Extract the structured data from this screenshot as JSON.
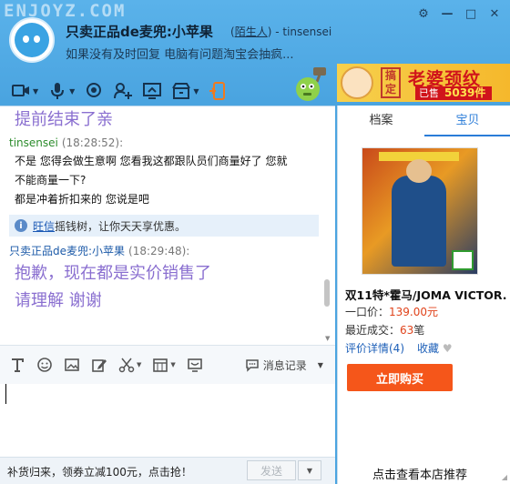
{
  "title_bar": {
    "watermark": "ENJOYZ.COM",
    "contact_name": "只卖正品de麦兜:小苹果",
    "tag_open": "(",
    "tag": "陌生人",
    "tag_close": ")",
    "account": "- tinsensei",
    "status": "如果没有及时回复  电脑有问题淘宝会抽疯..."
  },
  "toolbar": {
    "icons": [
      "video-call-icon",
      "voice-icon",
      "webcam-icon",
      "add-contact-icon",
      "remote-screen-icon",
      "shop-icon",
      "transfer-phone-icon"
    ]
  },
  "ad": {
    "seal": "搞定",
    "headline": "老婆颈纹",
    "sold_label": "已售",
    "sold_count": "5039件"
  },
  "chat": {
    "messages": [
      {
        "type": "big",
        "text": "提前结束了亲"
      },
      {
        "type": "sender",
        "name": "tinsensei",
        "time": "(18:28:52):"
      },
      {
        "type": "text",
        "text": "不是 您得会做生意啊 您看我这都跟队员们商量好了 您就"
      },
      {
        "type": "text",
        "text": "不能商量一下?"
      },
      {
        "type": "text",
        "text": "都是冲着折扣来的 您说是吧"
      },
      {
        "type": "notice",
        "link": "旺信",
        "text": "摇钱树，让你天天享优惠。"
      },
      {
        "type": "sender2",
        "name": "只卖正品de麦兜:小苹果",
        "time": "(18:29:48):"
      },
      {
        "type": "big",
        "text": "抱歉，现在都是实价销售了"
      },
      {
        "type": "big",
        "text": "请理解 谢谢"
      }
    ]
  },
  "input_toolbar": {
    "history_label": "消息记录"
  },
  "bottom": {
    "promo": "补货归来，领券立减100元，点击抢！",
    "send_label": "发送"
  },
  "side": {
    "tabs": [
      "档案",
      "宝贝"
    ],
    "active_tab": "宝贝",
    "product_title": "双11特*霍马/JOMA VICTOR...",
    "price_label": "一口价：",
    "price": "139.00元",
    "sales_label": "最近成交：",
    "sales": "63",
    "sales_unit": "笔",
    "review_link": "评价详情(4)",
    "favorite_link": "收藏",
    "buy_label": "立即购买",
    "shop_link": "点击查看本店推荐"
  },
  "colors": {
    "title_bg": "#4aa4e0",
    "accent_blue": "#2a7cd8",
    "buy_orange": "#f5561a",
    "price_red": "#e0431b",
    "big_msg_purple": "#8a6fd0"
  }
}
